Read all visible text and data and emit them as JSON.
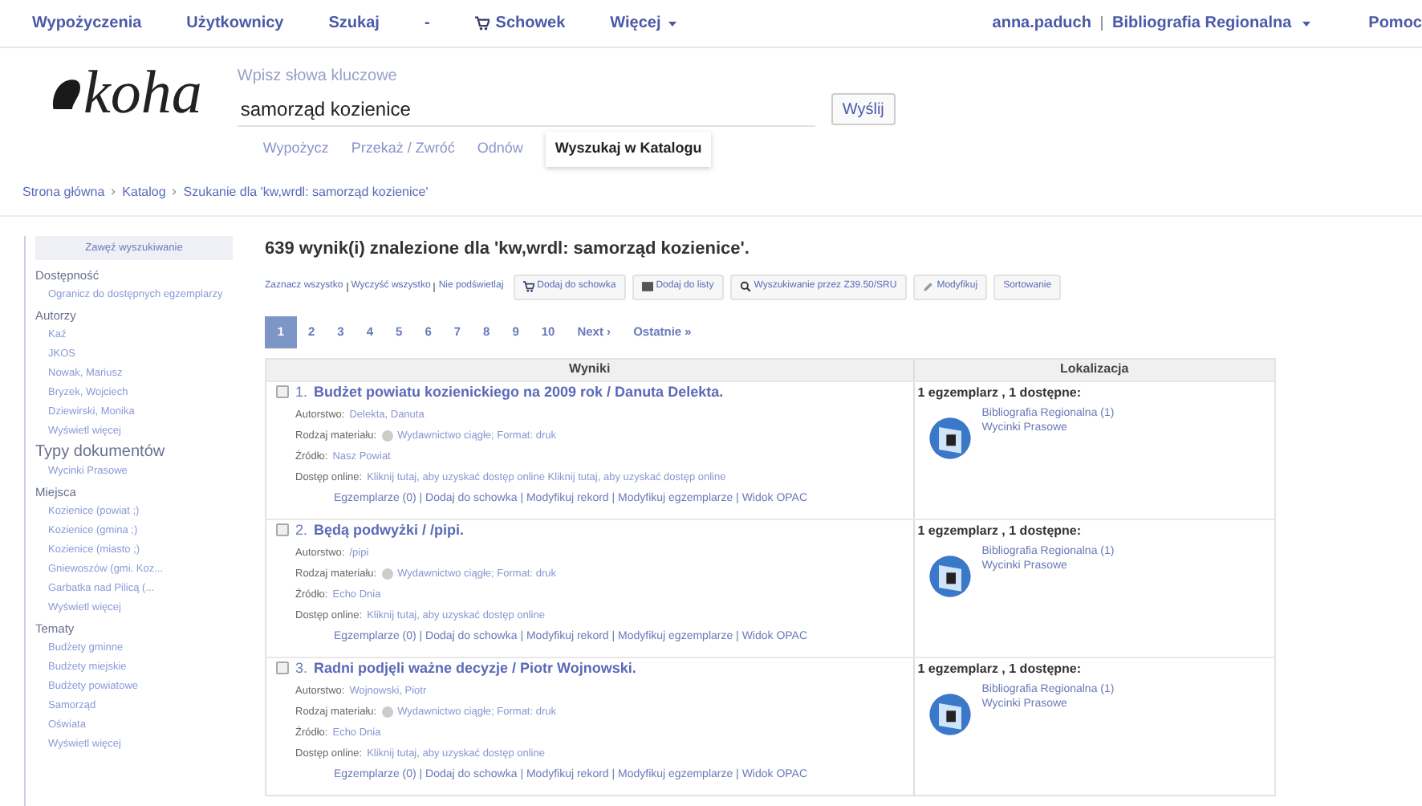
{
  "top_nav": {
    "left": [
      {
        "label": "Wypożyczenia",
        "kind": "link"
      },
      {
        "label": "Użytkownicy",
        "kind": "link"
      },
      {
        "label": "Szukaj",
        "kind": "link"
      },
      {
        "label": "-",
        "kind": "link"
      },
      {
        "label": "Schowek",
        "kind": "cart"
      },
      {
        "label": "Więcej",
        "kind": "menu"
      }
    ],
    "user": "anna.paduch",
    "library": "Bibliografia Regionalna",
    "help": "Pomoc"
  },
  "header": {
    "logo": "koha",
    "search_label": "Wpisz słowa kluczowe",
    "search_value": "samorząd kozienice",
    "submit": "Wyślij",
    "tabs": [
      {
        "label": "Wypożycz",
        "selected": false
      },
      {
        "label": "Przekaż / Zwróć",
        "selected": false
      },
      {
        "label": "Odnów",
        "selected": false
      },
      {
        "label": "Wyszukaj w Katalogu",
        "selected": true
      }
    ]
  },
  "breadcrumb": [
    "Strona główna",
    "Katalog",
    "Szukanie dla 'kw,wrdl: samorząd kozienice'"
  ],
  "sidebar": {
    "title": "Zawęź wyszukiwanie",
    "groups": [
      {
        "heading": "Dostępność",
        "items": [
          "Ogranicz do dostępnych egzemplarzy"
        ]
      },
      {
        "heading": "Autorzy",
        "items": [
          "Kaź",
          "JKOS",
          "Nowak, Mariusz",
          "Bryzek, Wojciech",
          "Dziewirski, Monika",
          "Wyświetl więcej"
        ]
      },
      {
        "heading": "Typy dokumentów",
        "items": [
          "Wycinki Prasowe"
        ]
      },
      {
        "heading": "Miejsca",
        "items": [
          "Kozienice (powiat ;)",
          "Kozienice (gmina ;)",
          "Kozienice (miasto ;)",
          "Gniewoszów (gmi. Koz...",
          "Garbatka nad Pilicą (...",
          "Wyświetl więcej"
        ]
      },
      {
        "heading": "Tematy",
        "items": [
          "Budżety gminne",
          "Budżety miejskie",
          "Budżety powiatowe",
          "Samorząd",
          "Oświata",
          "Wyświetl więcej"
        ]
      }
    ]
  },
  "results_summary": "639 wynik(i) znalezione dla 'kw,wrdl: samorząd kozienice'.",
  "toolbar": {
    "select_links": [
      "Zaznacz wszystko",
      "Wyczyść wszystko",
      "Nie podświetlaj"
    ],
    "buttons": [
      {
        "label": "Dodaj do schowka",
        "kind": "cart"
      },
      {
        "label": "Dodaj do listy",
        "kind": "list"
      },
      {
        "label": "Wyszukiwanie przez Z39.50/SRU",
        "kind": "search"
      },
      {
        "label": "Modyfikuj",
        "kind": "edit"
      },
      {
        "label": "Sortowanie",
        "kind": "plain"
      }
    ]
  },
  "pagination": [
    {
      "label": "1",
      "selected": true
    },
    {
      "label": "2",
      "selected": false
    },
    {
      "label": "3",
      "selected": false
    },
    {
      "label": "4",
      "selected": false
    },
    {
      "label": "5",
      "selected": false
    },
    {
      "label": "6",
      "selected": false
    },
    {
      "label": "7",
      "selected": false
    },
    {
      "label": "8",
      "selected": false
    },
    {
      "label": "9",
      "selected": false
    },
    {
      "label": "10",
      "selected": false
    },
    {
      "label": "Next ›",
      "selected": false
    },
    {
      "label": "Ostatnie »",
      "selected": false
    }
  ],
  "table": {
    "columns": [
      "Wyniki",
      "Lokalizacja"
    ],
    "rows": [
      {
        "checked": false,
        "number": "1.",
        "title": "Budżet powiatu kozienickiego na 2009 rok / Danuta Delekta.",
        "fields": [
          {
            "label": "Autorstwo:",
            "value": "Delekta, Danuta"
          },
          {
            "label": "Rodzaj materiału:",
            "value": "Wydawnictwo ciągłe; Format: druk"
          },
          {
            "label": "Źródło:",
            "value": "Nasz Powiat"
          },
          {
            "label": "Dostęp online:",
            "value": "Kliknij tutaj, aby uzyskać dostęp online Kliknij tutaj, aby uzyskać dostęp online"
          }
        ],
        "actions": "Egzemplarze (0) | Dodaj do schowka | Modyfikuj rekord | Modyfikuj egzemplarze | Widok OPAC",
        "availability": "1 egzemplarz , 1 dostępne:",
        "location": "Bibliografia Regionalna (1)",
        "collection": "Wycinki Prasowe"
      },
      {
        "checked": false,
        "number": "2.",
        "title": "Będą podwyżki / /pipi.",
        "fields": [
          {
            "label": "Autorstwo:",
            "value": "/pipi"
          },
          {
            "label": "Rodzaj materiału:",
            "value": "Wydawnictwo ciągłe; Format: druk"
          },
          {
            "label": "Źródło:",
            "value": "Echo Dnia"
          },
          {
            "label": "Dostęp online:",
            "value": "Kliknij tutaj, aby uzyskać dostęp online"
          }
        ],
        "actions": "Egzemplarze (0) | Dodaj do schowka | Modyfikuj rekord | Modyfikuj egzemplarze | Widok OPAC",
        "availability": "1 egzemplarz , 1 dostępne:",
        "location": "Bibliografia Regionalna (1)",
        "collection": "Wycinki Prasowe"
      },
      {
        "checked": false,
        "number": "3.",
        "title": "Radni podjęli ważne decyzje / Piotr Wojnowski.",
        "fields": [
          {
            "label": "Autorstwo:",
            "value": "Wojnowski, Piotr"
          },
          {
            "label": "Rodzaj materiału:",
            "value": "Wydawnictwo ciągłe; Format: druk"
          },
          {
            "label": "Źródło:",
            "value": "Echo Dnia"
          },
          {
            "label": "Dostęp online:",
            "value": "Kliknij tutaj, aby uzyskać dostęp online"
          }
        ],
        "actions": "Egzemplarze (0) | Dodaj do schowka | Modyfikuj rekord | Modyfikuj egzemplarze | Widok OPAC",
        "availability": "1 egzemplarz , 1 dostępne:",
        "location": "Bibliografia Regionalna (1)",
        "collection": "Wycinki Prasowe"
      }
    ]
  }
}
